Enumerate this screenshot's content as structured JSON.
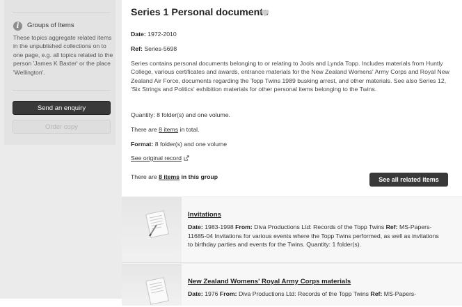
{
  "sidebar": {
    "groups_title": "Groups of Items",
    "groups_desc": "These topics aggregate related items in the unpublished collections on to one page, e.g. all topics related to the person 'James K Baxter' or the place 'Wellington'.",
    "enquiry_button": "Send an enquiry",
    "order_button": "Order copy"
  },
  "record": {
    "title": "Series 1 Personal documents",
    "date_label": "Date:",
    "date_value": "1972-2010",
    "ref_label": "Ref:",
    "ref_value": "Series-5698",
    "description": "Series contains personal documents belonging to or relating to Jools and Lynda Topp. Includes materials from Huntly College, various certificates and awards, entrance materials for the New Zealand Womens' Army Corps and Royal New Zealand Air Force, documents regarding the Topp Twins 1989 busking arrest, and other materials. See also Series 12, 'Six Strings and Politics' exhibition materials for other personal items belonging to the Twins.",
    "quantity": "Quantity: 8 folder(s) and one volume.",
    "total_prefix": "There are ",
    "total_link": "8 items",
    "total_suffix": " in total.",
    "format_label": "Format:",
    "format_value": "8 folder(s) and one volume",
    "original_link": "See original record",
    "group_prefix": "There are ",
    "group_link": "8 items",
    "group_suffix": " in this group",
    "related_button": "See all related items"
  },
  "items": [
    {
      "title": "Invitations",
      "date_label": "Date:",
      "date": "1983-1998",
      "from_label": "From:",
      "from": "Diva Productions Ltd: Records of the Topp Twins",
      "ref_label": "Ref:",
      "ref": "MS-Papers-11685-04",
      "desc": "Invitations for various events where the Topp Twins performed, as well as invitations to birthday parties and events for the Twins. Quantity: 1 folder(s)."
    },
    {
      "title": "New Zealand Womens' Royal Army Corps materials",
      "date_label": "Date:",
      "date": "1976",
      "from_label": "From:",
      "from": "Diva Productions Ltd: Records of the Topp Twins",
      "ref_label": "Ref:",
      "ref": "MS-Papers-"
    }
  ],
  "colors": {
    "dark_button": "#393939",
    "sidebar_bg": "#ebebeb",
    "item_bg": "#f7f7f7"
  },
  "icons": {
    "info": "info-icon",
    "heart": "heart-icon",
    "external": "external-link-icon",
    "document": "document-icon"
  }
}
